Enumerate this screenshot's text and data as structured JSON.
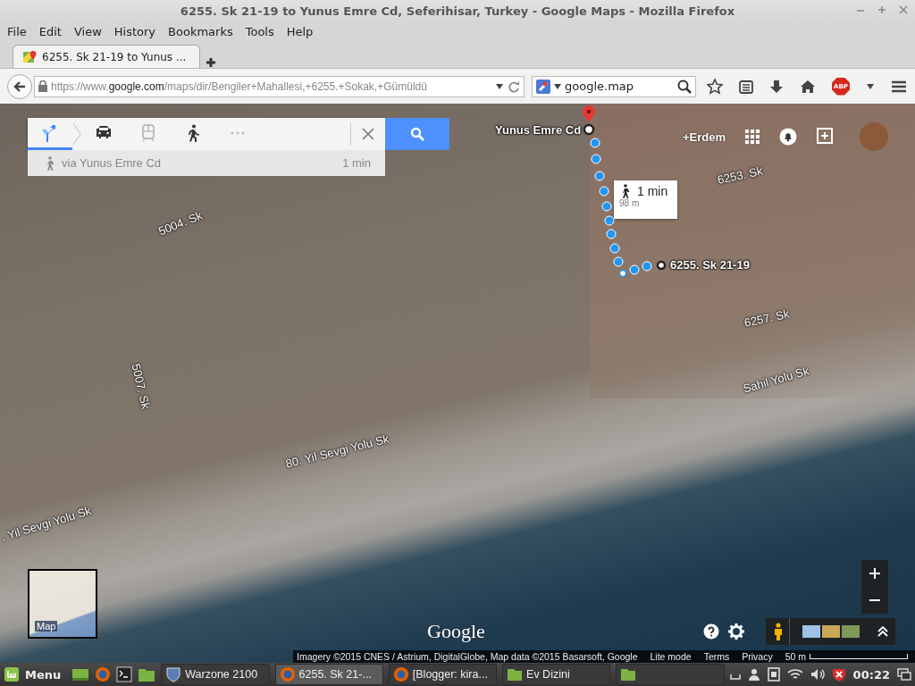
{
  "window": {
    "title": "6255. Sk 21-19 to Yunus Emre Cd, Seferihisar, Turkey - Google Maps - Mozilla Firefox"
  },
  "menu": [
    "File",
    "Edit",
    "View",
    "History",
    "Bookmarks",
    "Tools",
    "Help"
  ],
  "tabs": [
    {
      "label": "6255. Sk 21-19 to Yunus ...",
      "selected": true
    }
  ],
  "address": {
    "prefix": "https://www.",
    "domain": "google.com",
    "path": "/maps/dir/Bengiler+Mahallesi,+6255.+Sokak,+Gümüldü"
  },
  "search": {
    "value": "google.map"
  },
  "addon_badge": "ABP",
  "directions": {
    "modes": [
      {
        "kind": "best",
        "selected": true
      },
      {
        "kind": "car",
        "selected": false
      },
      {
        "kind": "transit",
        "selected": false
      },
      {
        "kind": "walk",
        "selected": false
      },
      {
        "kind": "more",
        "selected": false
      }
    ],
    "route": {
      "via": "via Yunus Emre Cd",
      "time": "1 min"
    }
  },
  "map": {
    "destination": "Yunus Emre Cd",
    "origin": "6255. Sk 21-19",
    "callout": {
      "time": "1 min",
      "distance": "98 m"
    },
    "account": "+Erdem",
    "street_labels": [
      "5004. Sk",
      "5007. Sk",
      "80. Yil Sevgi Yolu Sk",
      ". Yil Sevgi Yolu Sk",
      "6253. Sk",
      "6257. Sk",
      "Sahil Yolu Sk"
    ],
    "minimap_label": "Map",
    "logo": "Google",
    "attribution": "Imagery ©2015 CNES / Astrium, DigitalGlobe, Map data ©2015 Basarsoft, Google",
    "footer_links": [
      "Lite mode",
      "Terms",
      "Privacy"
    ],
    "scale": "50 m"
  },
  "taskbar": {
    "menu": "Menu",
    "tasks": [
      {
        "kind": "game",
        "label": "Warzone 2100",
        "selected": false
      },
      {
        "kind": "browser",
        "label": "6255. Sk 21-...",
        "selected": true
      },
      {
        "kind": "browser",
        "label": "[Blogger: kira...",
        "selected": false
      },
      {
        "kind": "folder",
        "label": "Ev Dizini",
        "selected": false
      },
      {
        "kind": "folder",
        "selected": false
      }
    ],
    "clock": "00:22"
  }
}
